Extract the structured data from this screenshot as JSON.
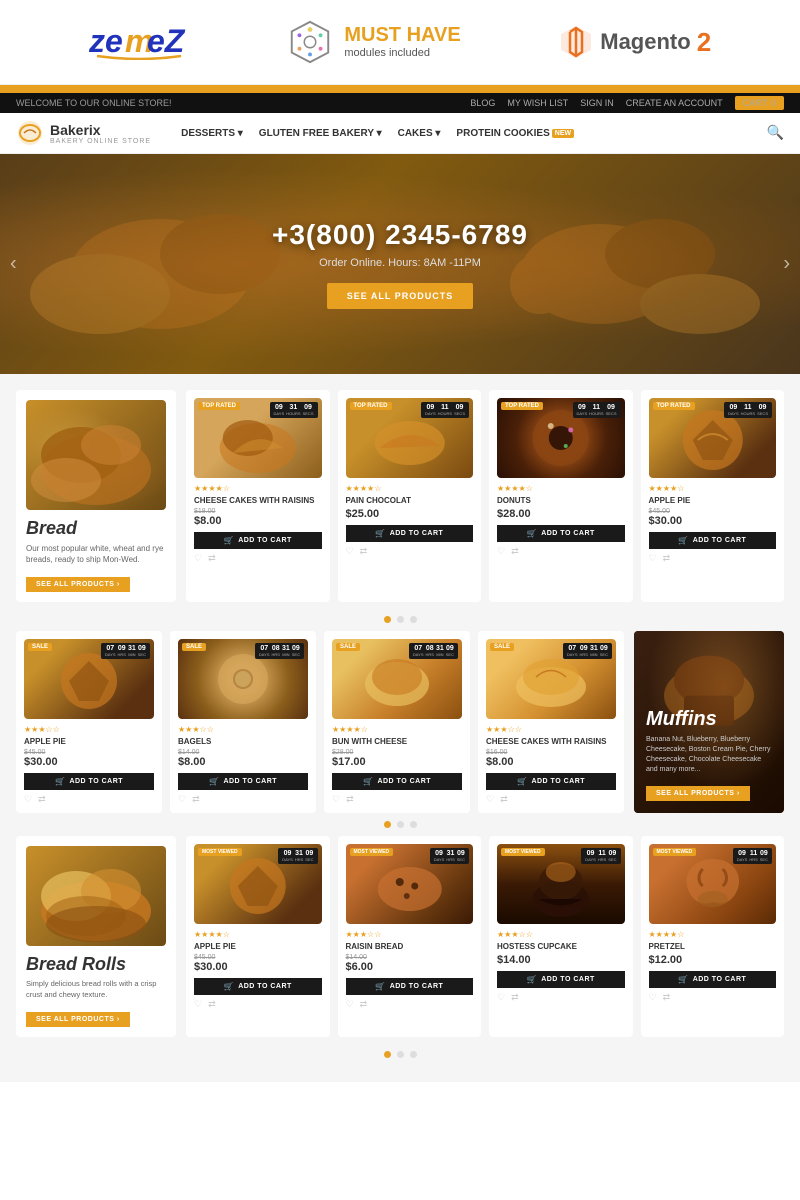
{
  "top_banner": {
    "zemes_logo": "ZemeZ",
    "must_have": {
      "title_line1": "MUST HAVE",
      "title_line2": "modules included"
    },
    "magento": {
      "label": "Magento",
      "version": "2"
    }
  },
  "store": {
    "topbar": {
      "welcome": "WELCOME TO OUR ONLINE STORE!",
      "links": [
        "BLOG",
        "MY WISH LIST",
        "SIGN IN",
        "CREATE AN ACCOUNT"
      ],
      "cart": "CART: 0"
    },
    "brand": {
      "name": "Bakerix",
      "sub": "BAKERY ONLINE STORE"
    },
    "nav": [
      "DESSERTS",
      "GLUTEN FREE BAKERY",
      "CAKES",
      "PROTEIN COOKIES"
    ],
    "protein_badge": "NEW"
  },
  "hero": {
    "phone": "+3(800) 2345-6789",
    "hours": "Order Online. Hours: 8AM -11PM",
    "cta": "SEE ALL PRODUCTS"
  },
  "section1": {
    "category": {
      "title": "Bread",
      "description": "Our most popular white, wheat and rye breads, ready to ship Mon-Wed.",
      "cta": "SEE ALL PRODUCTS ›"
    },
    "products": [
      {
        "name": "CHEESE CAKES WITH RAISINS",
        "price": "$8.00",
        "price_old": "$18.00",
        "badge": "TOP RATED",
        "timer": "09 31 09",
        "stars": 4,
        "img_class": "img-croissant"
      },
      {
        "name": "PAIN CHOCOLAT",
        "price": "$25.00",
        "price_old": "",
        "badge": "TOP RATED",
        "timer": "09 11 09",
        "stars": 4,
        "img_class": "img-pain"
      },
      {
        "name": "DONUTS",
        "price": "$28.00",
        "price_old": "",
        "badge": "TOP RATED",
        "timer": "09 11 09",
        "stars": 4,
        "img_class": "img-donut"
      },
      {
        "name": "APPLE PIE",
        "price": "$30.00",
        "price_old": "$45.00",
        "badge": "TOP RATED",
        "timer": "09 11 09",
        "stars": 4,
        "img_class": "img-apple-pie"
      }
    ]
  },
  "section2": {
    "products": [
      {
        "name": "APPLE PIE",
        "price": "$30.00",
        "price_old": "$45.00",
        "badge": "SALE",
        "timer": "07 09 31 09",
        "stars": 3,
        "img_class": "img-apple-pie"
      },
      {
        "name": "BAGELS",
        "price": "$8.00",
        "price_old": "$14.00",
        "badge": "SALE",
        "timer": "07 08 31 09",
        "stars": 3,
        "img_class": "img-bagels"
      },
      {
        "name": "BUN WITH CHEESE",
        "price": "$17.00",
        "price_old": "$28.00",
        "badge": "SALE",
        "timer": "07 08 31 09",
        "stars": 4,
        "img_class": "img-bun"
      },
      {
        "name": "CHEESE CAKES WITH RAISINS",
        "price": "$8.00",
        "price_old": "$16.00",
        "badge": "SALE",
        "timer": "07 09 31 09",
        "stars": 3,
        "img_class": "img-cheese-cake"
      }
    ],
    "muffins": {
      "title": "Muffins",
      "description": "Banana Nut, Blueberry, Blueberry Cheesecake, Boston Cream Pie, Cherry Cheesecake, Chocolate Cheesecake and many more...",
      "cta": "SEE ALL PRODUCTS ›"
    }
  },
  "section3": {
    "category": {
      "title": "Bread Rolls",
      "description": "Simply delicious bread rolls with a crisp crust and chewy texture.",
      "cta": "SEE ALL PRODUCTS ›"
    },
    "products": [
      {
        "name": "APPLE PIE",
        "price": "$30.00",
        "price_old": "$45.00",
        "badge": "MOST VIEWED",
        "timer": "09 31 09",
        "stars": 4,
        "img_class": "img-apple-pie"
      },
      {
        "name": "RAISIN BREAD",
        "price": "$6.00",
        "price_old": "$14.00",
        "badge": "MOST VIEWED",
        "timer": "09 31 09",
        "stars": 3,
        "img_class": "img-raisin"
      },
      {
        "name": "HOSTESS CUPCAKE",
        "price": "$14.00",
        "price_old": "",
        "badge": "MOST VIEWED",
        "timer": "09 11 09",
        "stars": 3,
        "img_class": "img-cupcake"
      },
      {
        "name": "PRETZEL",
        "price": "$12.00",
        "price_old": "",
        "badge": "MOST VIEWED",
        "timer": "09 11 09",
        "stars": 4,
        "img_class": "img-pretzel"
      }
    ]
  },
  "add_to_cart_label": "ADD TO CART",
  "see_all_label": "SEE ALL PRODUCTS ›"
}
